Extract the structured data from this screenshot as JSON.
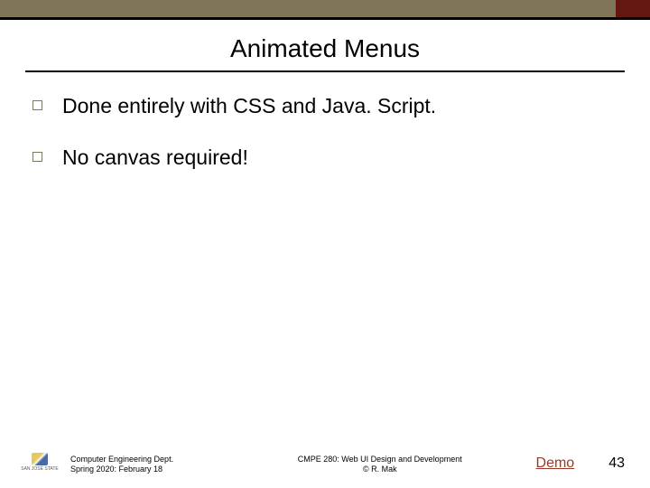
{
  "title": "Animated Menus",
  "bullets": [
    "Done entirely with CSS and Java. Script.",
    "No canvas required!"
  ],
  "footer": {
    "left_line1": "Computer Engineering Dept.",
    "left_line2": "Spring 2020: February 18",
    "center_line1": "CMPE 280: Web UI Design and Development",
    "center_line2": "© R. Mak",
    "demo": "Demo",
    "page": "43",
    "logo_text": "SAN JOSÉ STATE"
  }
}
